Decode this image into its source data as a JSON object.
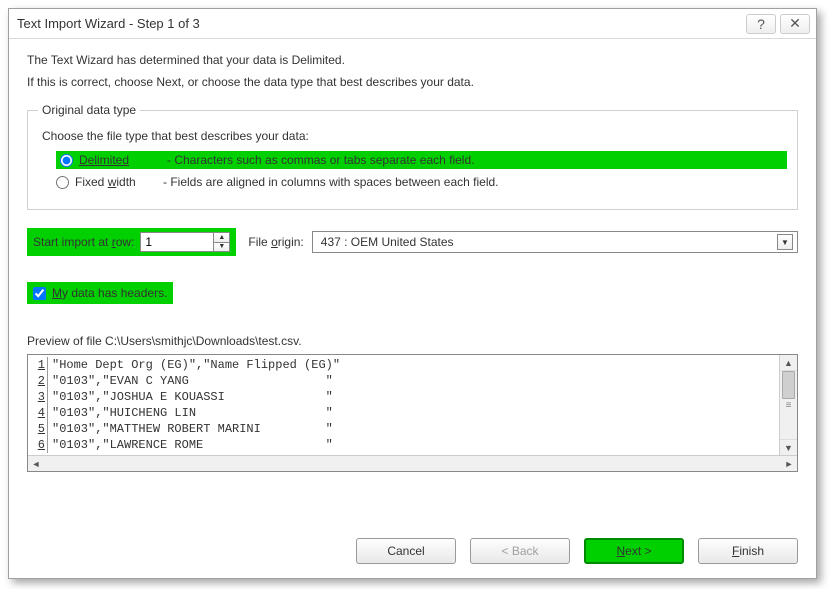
{
  "title": "Text Import Wizard - Step 1 of 3",
  "intro1": "The Text Wizard has determined that your data is Delimited.",
  "intro2": "If this is correct, choose Next, or choose the data type that best describes your data.",
  "group": {
    "legend": "Original data type",
    "prompt": "Choose the file type that best describes your data:",
    "delimited_label": "Delimited",
    "delimited_desc": "- Characters such as commas or tabs separate each field.",
    "fixed_label": "Fixed width",
    "fixed_desc": "- Fields are aligned in columns with spaces between each field."
  },
  "start_row": {
    "label_pre": "Start import at ",
    "label_u": "r",
    "label_post": "ow:",
    "value": "1"
  },
  "origin": {
    "label_pre": "File ",
    "label_u": "o",
    "label_post": "rigin:",
    "value": "437 : OEM United States"
  },
  "headers": {
    "label_u": "M",
    "label_post": "y data has headers."
  },
  "preview": {
    "label": "Preview of file C:\\Users\\smithjc\\Downloads\\test.csv.",
    "rows": [
      "\"Home Dept Org (EG)\",\"Name Flipped (EG)\"",
      "\"0103\",\"EVAN C YANG                   \"",
      "\"0103\",\"JOSHUA E KOUASSI              \"",
      "\"0103\",\"HUICHENG LIN                  \"",
      "\"0103\",\"MATTHEW ROBERT MARINI         \"",
      "\"0103\",\"LAWRENCE ROME                 \""
    ]
  },
  "buttons": {
    "cancel": "Cancel",
    "back": "< Back",
    "next": "Next >",
    "finish": "Finish"
  }
}
